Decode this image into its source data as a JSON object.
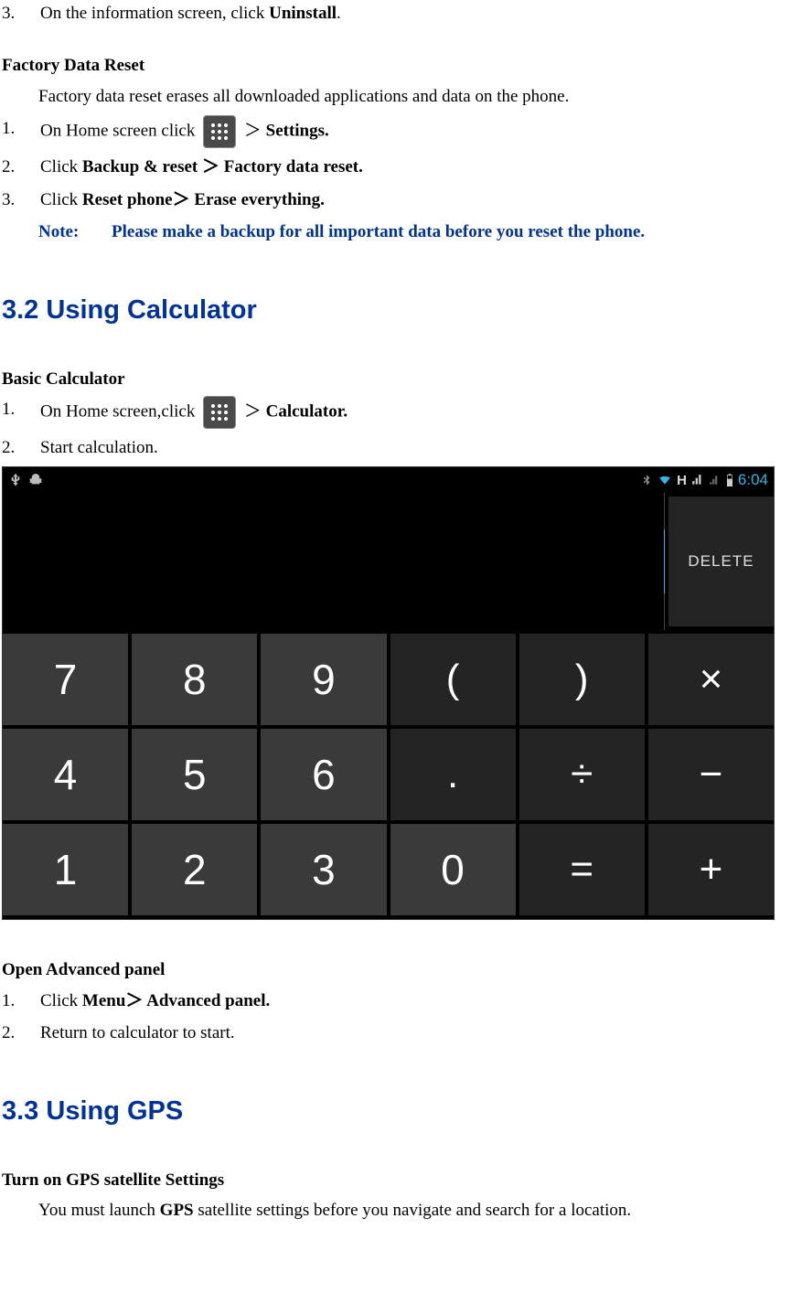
{
  "step3": {
    "num": "3.",
    "pre": "On the information screen, click ",
    "bold": "Uninstall",
    "post": "."
  },
  "factory": {
    "heading": "Factory Data Reset",
    "intro": "Factory data reset erases all downloaded applications and data on the phone.",
    "s1": {
      "num": "1.",
      "pre": "On Home screen click ",
      "gt": " ＞ ",
      "bold": "Settings."
    },
    "s2": {
      "num": "2.",
      "pre": "Click ",
      "b1": "Backup & reset",
      "mid": " ＞ ",
      "b2": "Factory data reset."
    },
    "s3": {
      "num": "3.",
      "pre": "Click ",
      "b1": "Reset phone",
      "mid": "＞ ",
      "b2": "Erase everything."
    },
    "note": {
      "label": "Note:",
      "text": "Please make a backup for all important data before you reset the phone."
    }
  },
  "sec32": {
    "title": "3.2 Using Calculator",
    "basic": "Basic Calculator",
    "s1": {
      "num": "1.",
      "pre": "On Home screen,click ",
      "gt": " ＞ ",
      "bold": "Calculator."
    },
    "s2": {
      "num": "2.",
      "text": "Start calculation."
    }
  },
  "calc": {
    "clock": "6:04",
    "delete": "DELETE",
    "keys": [
      "7",
      "8",
      "9",
      "(",
      ")",
      "×",
      "4",
      "5",
      "6",
      ".",
      "÷",
      "−",
      "1",
      "2",
      "3",
      "0",
      "=",
      "+"
    ],
    "dark_indices": [
      3,
      4,
      5,
      9,
      10,
      11,
      16,
      17
    ]
  },
  "adv": {
    "heading": "Open Advanced panel",
    "s1": {
      "num": "1.",
      "pre": "Click ",
      "b1": "Menu",
      "mid": "＞ ",
      "b2": "Advanced panel."
    },
    "s2": {
      "num": "2.",
      "text": "Return to calculator to start."
    }
  },
  "sec33": {
    "title": "3.3 Using GPS",
    "heading": "Turn on GPS satellite Settings",
    "body_pre": "You must launch ",
    "body_bold": "GPS",
    "body_post": " satellite settings before you navigate and search for a location."
  }
}
